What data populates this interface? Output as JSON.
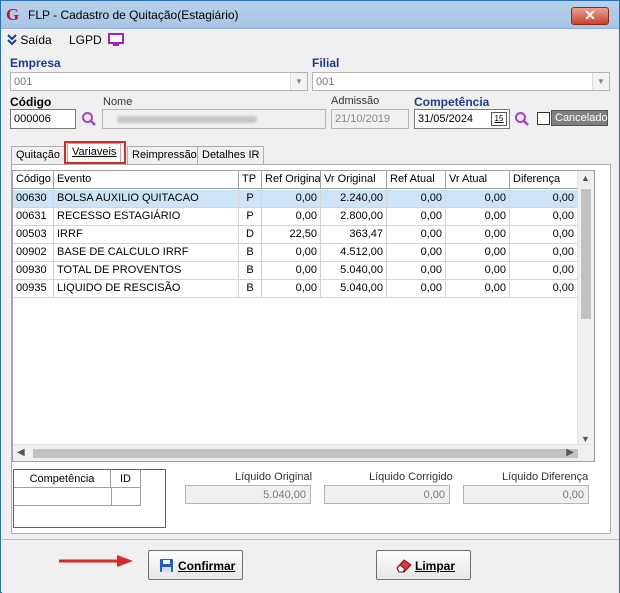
{
  "window": {
    "title": "FLP - Cadastro de Quitação(Estagiário)",
    "close_glyph": "✕",
    "app_icon": "G"
  },
  "menu": {
    "saida": "Saída",
    "lgpd": "LGPD"
  },
  "empresa": {
    "label": "Empresa",
    "value": "001"
  },
  "filial": {
    "label": "Filial",
    "value": "001"
  },
  "codigo": {
    "label": "Código",
    "value": "000006"
  },
  "nome": {
    "label": "Nome"
  },
  "admissao": {
    "label": "Admissão",
    "value": "21/10/2019"
  },
  "competencia": {
    "label": "Competência",
    "value": "31/05/2024",
    "calendar": "15"
  },
  "cancelado": {
    "label": "Cancelado"
  },
  "tabs": [
    {
      "label": "Quitação"
    },
    {
      "label": "Variaveis"
    },
    {
      "label": "Reimpressão"
    },
    {
      "label": "Detalhes IR"
    }
  ],
  "grid": {
    "columns": [
      "Código",
      "Evento",
      "TP",
      "Ref Original",
      "Vr Original",
      "Ref Atual",
      "Vr Atual",
      "Diferença"
    ],
    "rows": [
      [
        "00630",
        "BOLSA AUXILIO QUITACAO",
        "P",
        "0,00",
        "2.240,00",
        "0,00",
        "0,00",
        "0,00"
      ],
      [
        "00631",
        "RECESSO ESTAGIÁRIO",
        "P",
        "0,00",
        "2.800,00",
        "0,00",
        "0,00",
        "0,00"
      ],
      [
        "00503",
        "IRRF",
        "D",
        "22,50",
        "363,47",
        "0,00",
        "0,00",
        "0,00"
      ],
      [
        "00902",
        "BASE DE CALCULO IRRF",
        "B",
        "0,00",
        "4.512,00",
        "0,00",
        "0,00",
        "0,00"
      ],
      [
        "00930",
        "TOTAL DE PROVENTOS",
        "B",
        "0,00",
        "5.040,00",
        "0,00",
        "0,00",
        "0,00"
      ],
      [
        "00935",
        "LIQUIDO DE RESCISÃO",
        "B",
        "0,00",
        "5.040,00",
        "0,00",
        "0,00",
        "0,00"
      ]
    ]
  },
  "mini_grid": {
    "columns": [
      "Competência",
      "ID"
    ]
  },
  "totals": {
    "liquido_original": {
      "label": "Líquido Original",
      "value": "5.040,00"
    },
    "liquido_corrigido": {
      "label": "Líquido Corrigido",
      "value": "0,00"
    },
    "liquido_diferenca": {
      "label": "Líquido Diferença",
      "value": "0,00"
    }
  },
  "buttons": {
    "confirmar": "Confirmar",
    "limpar": "Limpar"
  },
  "colors": {
    "label_blue": "#1f3a93",
    "selected_row": "#cde3f7",
    "annotation_red": "#d42a2a"
  }
}
